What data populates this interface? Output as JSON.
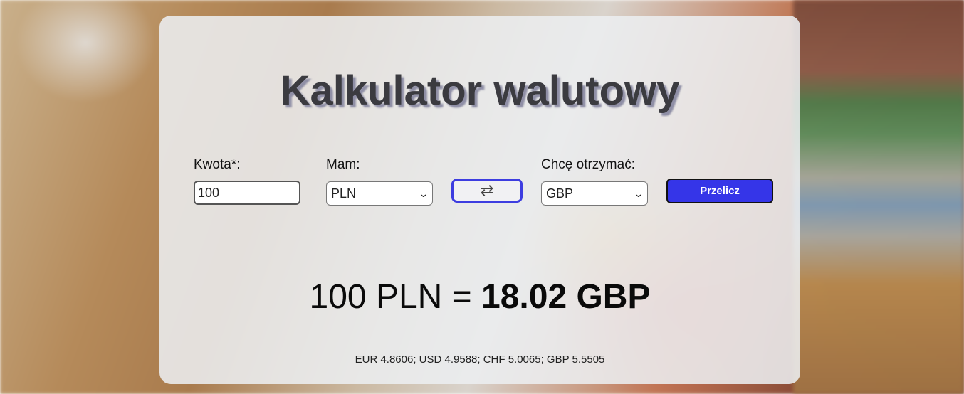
{
  "title": "Kalkulator walutowy",
  "form": {
    "amount_label": "Kwota*:",
    "amount_value": "100",
    "from_label": "Mam:",
    "from_value": "PLN",
    "to_label": "Chcę otrzymać:",
    "to_value": "GBP",
    "swap_icon": "⇄",
    "submit_label": "Przelicz"
  },
  "result": {
    "left": "100 PLN = ",
    "right": "18.02 GBP"
  },
  "rates": "EUR 4.8606; USD 4.9588; CHF 5.0065; GBP 5.5505",
  "colors": {
    "accent": "#3535e8",
    "title_shadow": "#8f8fa6"
  }
}
